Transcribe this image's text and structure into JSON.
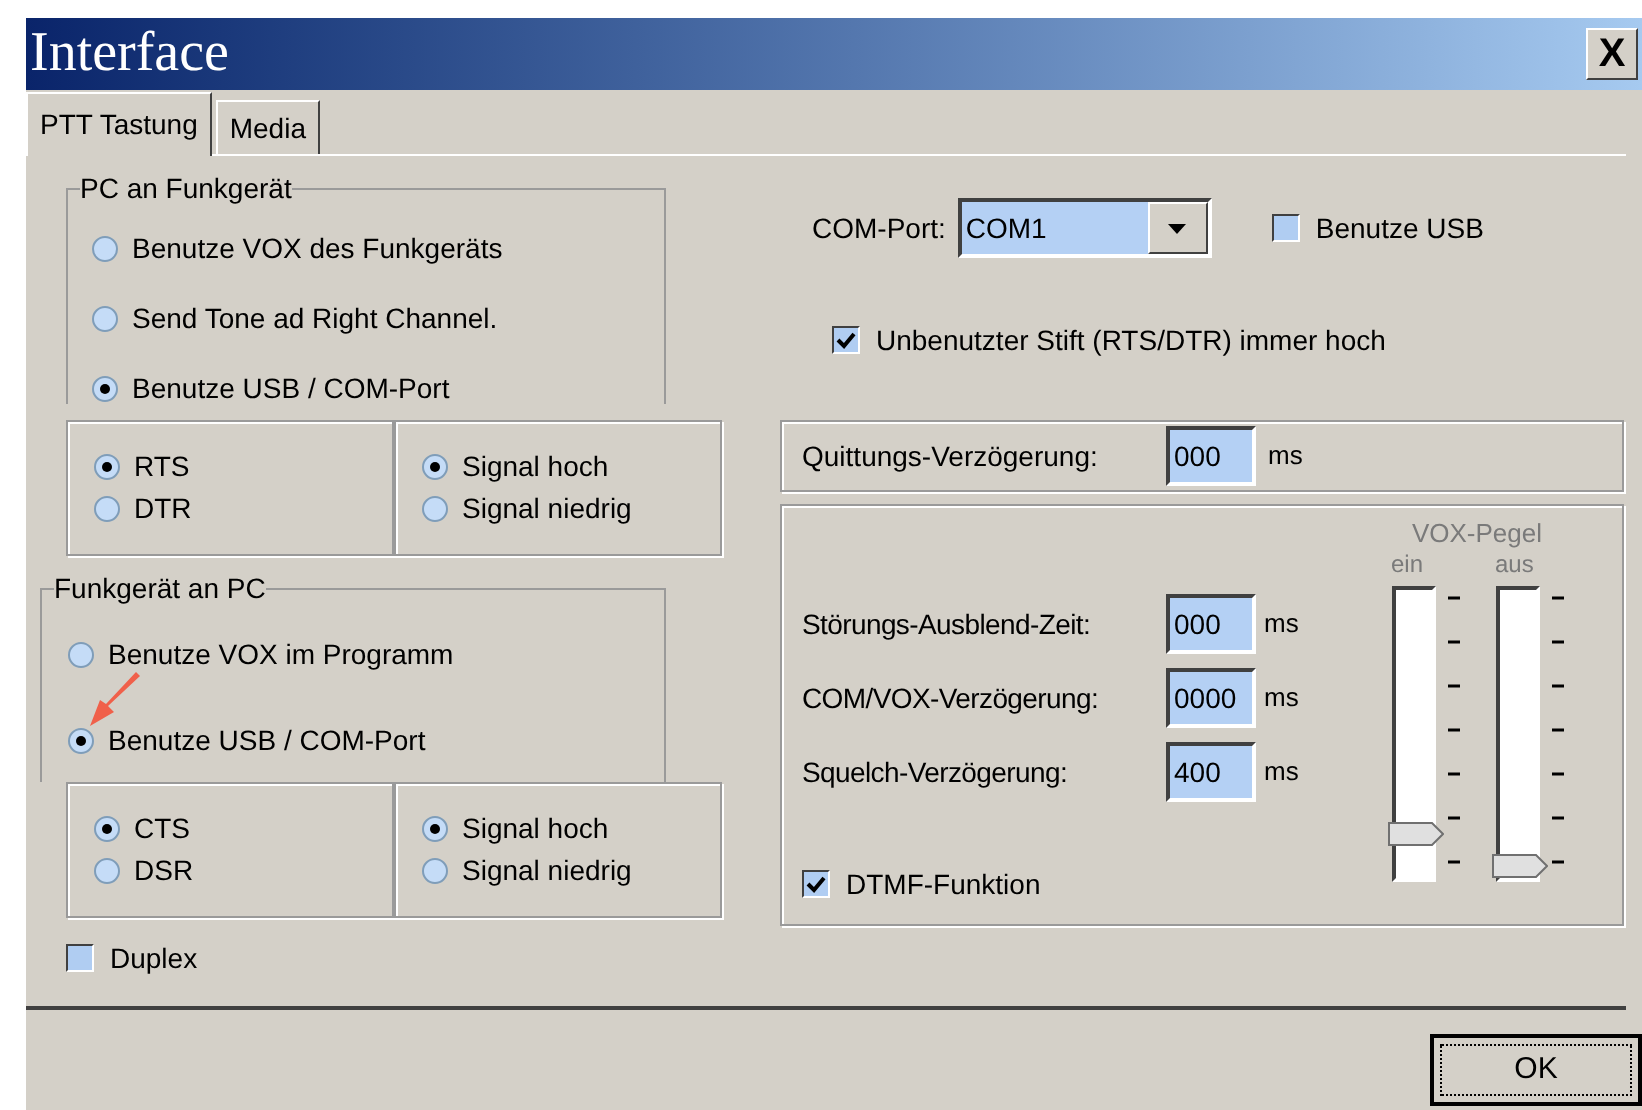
{
  "window": {
    "title": "Interface",
    "close_label": "X"
  },
  "tabs": [
    {
      "label": "PTT Tastung",
      "selected": true
    },
    {
      "label": "Media",
      "selected": false
    }
  ],
  "pc_to_radio": {
    "title": "PC an Funkgerät",
    "options": [
      {
        "label": "Benutze VOX des Funkgeräts",
        "selected": false
      },
      {
        "label": "Send Tone ad Right Channel.",
        "selected": false
      },
      {
        "label": "Benutze USB / COM-Port",
        "selected": true
      }
    ],
    "line": [
      {
        "label": "RTS",
        "selected": true
      },
      {
        "label": "DTR",
        "selected": false
      }
    ],
    "signal": [
      {
        "label": "Signal hoch",
        "selected": true
      },
      {
        "label": "Signal niedrig",
        "selected": false
      }
    ]
  },
  "radio_to_pc": {
    "title": "Funkgerät an PC",
    "options": [
      {
        "label": "Benutze VOX im Programm",
        "selected": false
      },
      {
        "label": "Benutze USB / COM-Port",
        "selected": true
      }
    ],
    "line": [
      {
        "label": "CTS",
        "selected": true
      },
      {
        "label": "DSR",
        "selected": false
      }
    ],
    "signal": [
      {
        "label": "Signal hoch",
        "selected": true
      },
      {
        "label": "Signal niedrig",
        "selected": false
      }
    ]
  },
  "duplex": {
    "label": "Duplex",
    "checked": false
  },
  "com_port": {
    "label": "COM-Port:",
    "value": "COM1"
  },
  "use_usb": {
    "label": "Benutze USB",
    "checked": false
  },
  "unused_pin_high": {
    "label": "Unbenutzter Stift (RTS/DTR) immer hoch",
    "checked": true
  },
  "ack_delay": {
    "label": "Quittungs-Verzögerung:",
    "value": "000",
    "unit": "ms"
  },
  "timings": [
    {
      "label": "Störungs-Ausblend-Zeit:",
      "value": "000",
      "unit": "ms"
    },
    {
      "label": "COM/VOX-Verzögerung:",
      "value": "0000",
      "unit": "ms"
    },
    {
      "label": "Squelch-Verzögerung:",
      "value": "400",
      "unit": "ms"
    }
  ],
  "dtmf": {
    "label": "DTMF-Funktion",
    "checked": true
  },
  "vox_level": {
    "title": "VOX-Pegel",
    "sliders": [
      {
        "label": "ein",
        "level": 0.12
      },
      {
        "label": "aus",
        "level": 0
      }
    ]
  },
  "buttons": [
    {
      "label": "OK"
    }
  ]
}
